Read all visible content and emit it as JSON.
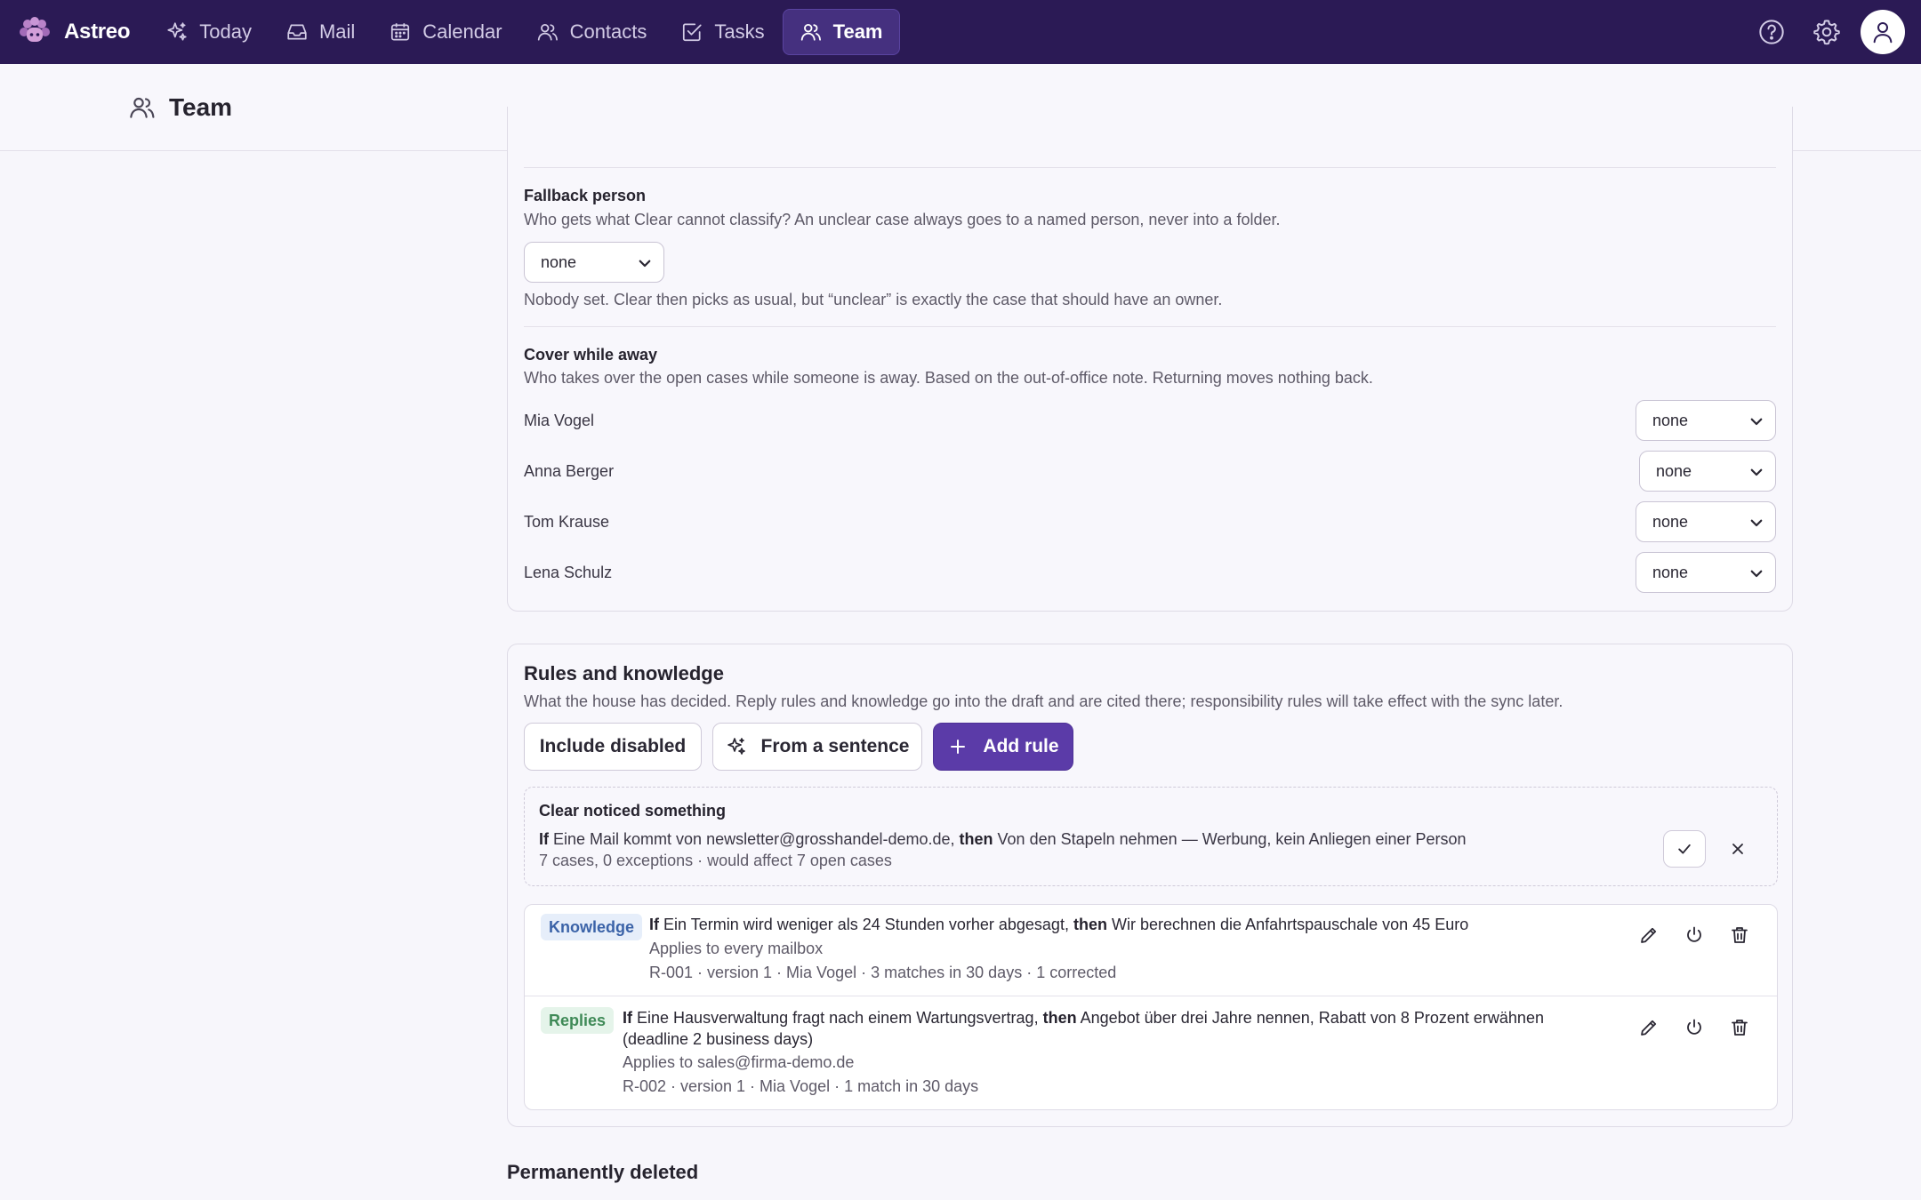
{
  "app": {
    "name": "Astreo",
    "nav": [
      {
        "label": "Today",
        "icon": "sparkle-icon"
      },
      {
        "label": "Mail",
        "icon": "inbox-icon"
      },
      {
        "label": "Calendar",
        "icon": "calendar-icon"
      },
      {
        "label": "Contacts",
        "icon": "contacts-icon"
      },
      {
        "label": "Tasks",
        "icon": "checkbox-icon"
      },
      {
        "label": "Team",
        "icon": "team-icon",
        "active": true
      }
    ],
    "accent": "#5b3ba8",
    "topbar_color": "#2b1a55"
  },
  "page": {
    "title": "Team"
  },
  "fallback": {
    "label": "Fallback person",
    "description": "Who gets what Clear cannot classify? An unclear case always goes to a named person, never into a folder.",
    "value": "none",
    "note": "Nobody set. Clear then picks as usual, but “unclear” is exactly the case that should have an owner."
  },
  "cover": {
    "label": "Cover while away",
    "description": "Who takes over the open cases while someone is away. Based on the out-of-office note. Returning moves nothing back.",
    "people": [
      {
        "name": "Mia Vogel",
        "value": "none"
      },
      {
        "name": "Anna Berger",
        "value": "none"
      },
      {
        "name": "Tom Krause",
        "value": "none"
      },
      {
        "name": "Lena Schulz",
        "value": "none"
      }
    ]
  },
  "rules": {
    "title": "Rules and knowledge",
    "description": "What the house has decided. Reply rules and knowledge go into the draft and are cited there; responsibility rules will take effect with the sync later.",
    "buttons": {
      "include_disabled": "Include disabled",
      "from_sentence": "From a sentence",
      "add_rule": "Add rule"
    },
    "suggestion": {
      "title": "Clear noticed something",
      "if_word": "If",
      "condition": "Eine Mail kommt von newsletter@grosshandel-demo.de,",
      "then_word": "then",
      "action": "Von den Stapeln nehmen — Werbung, kein Anliegen einer Person",
      "meta": "7 cases, 0 exceptions · would affect 7 open cases"
    },
    "items": [
      {
        "tag": "Knowledge",
        "if_word": "If",
        "condition": "Ein Termin wird weniger als 24 Stunden vorher abgesagt,",
        "then_word": "then",
        "action": "Wir berechnen die Anfahrtspauschale von 45 Euro",
        "scope": "Applies to every mailbox",
        "meta": "R-001 · version 1 · Mia Vogel · 3 matches in 30 days · 1 corrected"
      },
      {
        "tag": "Replies",
        "if_word": "If",
        "condition": "Eine Hausverwaltung fragt nach einem Wartungsvertrag,",
        "then_word": "then",
        "action": "Angebot über drei Jahre nennen, Rabatt von 8 Prozent erwähnen (deadline 2 business days)",
        "scope": "Applies to sales@firma-demo.de",
        "meta": "R-002 · version 1 · Mia Vogel · 1 match in 30 days"
      }
    ]
  },
  "deleted": {
    "title": "Permanently deleted"
  }
}
